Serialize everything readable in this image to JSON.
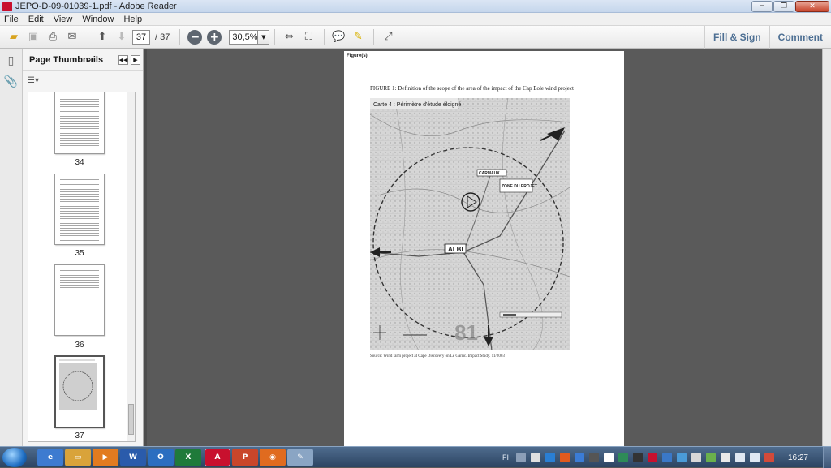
{
  "window": {
    "title": "JEPO-D-09-01039-1.pdf - Adobe Reader"
  },
  "menu": [
    "File",
    "Edit",
    "View",
    "Window",
    "Help"
  ],
  "toolbar": {
    "current_page": "37",
    "total_pages": "/ 37",
    "zoom": "30,5%",
    "fill_sign": "Fill & Sign",
    "comment": "Comment"
  },
  "panel": {
    "title": "Page Thumbnails",
    "thumbnails": [
      {
        "label": "34"
      },
      {
        "label": "35"
      },
      {
        "label": "36"
      },
      {
        "label": "37"
      }
    ]
  },
  "document": {
    "figure_header": "Figure(s)",
    "caption": "FIGURE 1: Definition of the scope of the area of the impact of the Cap Eole wind project",
    "map": {
      "title": "Carte 4 : Périmètre d'étude éloigné",
      "labels": {
        "carmaux": "CARMAUX",
        "zone": "ZONE DU PROJET",
        "albi": "ALBI",
        "road": "81"
      }
    },
    "source": "Source: Wind farm project at Cape Discovery on Le Garric. Impact Study. 11/2003"
  },
  "taskbar": {
    "lang": "FI",
    "clock": "16:27"
  }
}
